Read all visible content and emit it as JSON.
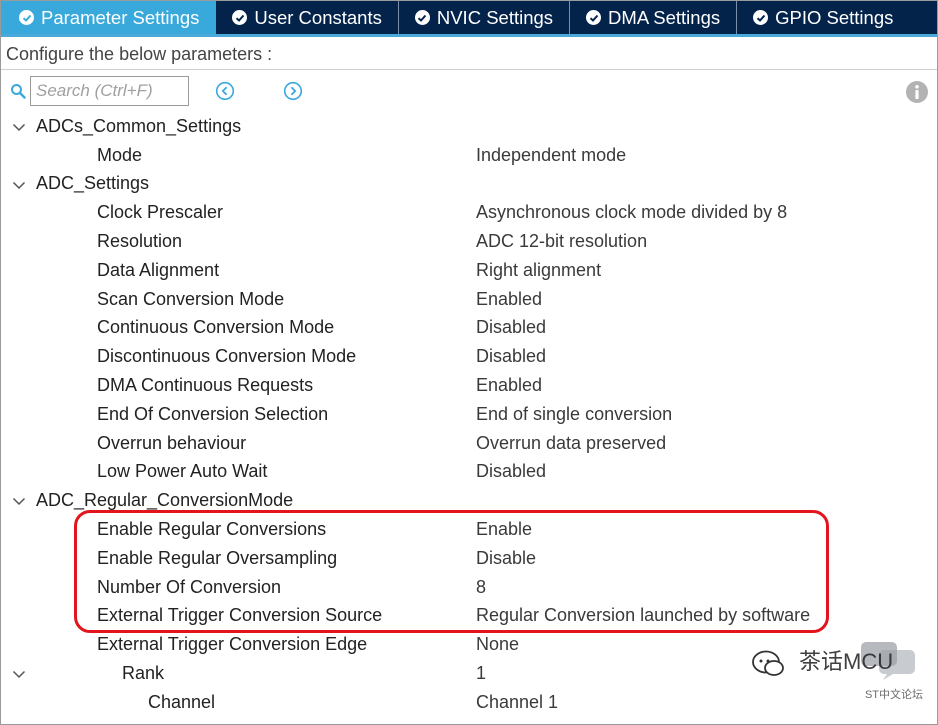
{
  "tabs": [
    {
      "label": "Parameter Settings",
      "active": true
    },
    {
      "label": "User Constants",
      "active": false
    },
    {
      "label": "NVIC Settings",
      "active": false
    },
    {
      "label": "DMA Settings",
      "active": false
    },
    {
      "label": "GPIO Settings",
      "active": false
    }
  ],
  "configure_text": "Configure the below parameters :",
  "search": {
    "placeholder": "Search (Ctrl+F)",
    "value": ""
  },
  "tree": {
    "common": {
      "title": "ADCs_Common_Settings",
      "params": [
        {
          "label": "Mode",
          "value": "Independent mode"
        }
      ]
    },
    "adc": {
      "title": "ADC_Settings",
      "params": [
        {
          "label": "Clock Prescaler",
          "value": "Asynchronous clock mode divided by 8"
        },
        {
          "label": "Resolution",
          "value": "ADC 12-bit resolution"
        },
        {
          "label": "Data Alignment",
          "value": "Right alignment"
        },
        {
          "label": "Scan Conversion Mode",
          "value": "Enabled"
        },
        {
          "label": "Continuous Conversion Mode",
          "value": "Disabled"
        },
        {
          "label": "Discontinuous Conversion Mode",
          "value": "Disabled"
        },
        {
          "label": "DMA Continuous Requests",
          "value": "Enabled"
        },
        {
          "label": "End Of Conversion Selection",
          "value": "End of single conversion"
        },
        {
          "label": "Overrun behaviour",
          "value": "Overrun data preserved"
        },
        {
          "label": "Low Power Auto Wait",
          "value": "Disabled"
        }
      ]
    },
    "regular": {
      "title": "ADC_Regular_ConversionMode",
      "params": [
        {
          "label": "Enable Regular Conversions",
          "value": "Enable"
        },
        {
          "label": "Enable Regular Oversampling",
          "value": "Disable"
        },
        {
          "label": "Number Of Conversion",
          "value": "8"
        },
        {
          "label": "External Trigger Conversion Source",
          "value": "Regular Conversion launched by software"
        },
        {
          "label": "External Trigger Conversion Edge",
          "value": "None"
        }
      ],
      "rank": {
        "label": "Rank",
        "value": "1"
      },
      "channel": {
        "label": "Channel",
        "value": "Channel 1"
      }
    }
  },
  "watermark": {
    "title": "茶话MCU",
    "sub": "ST中文论坛"
  },
  "colors": {
    "tabbar_bg": "#03234b",
    "tab_active_bg": "#39a9dc",
    "highlight_border": "#e3141d",
    "icon_blue": "#39a9dc"
  }
}
